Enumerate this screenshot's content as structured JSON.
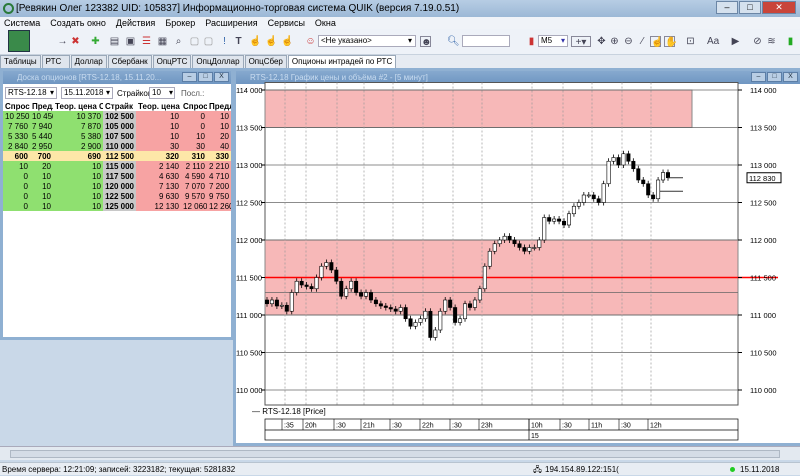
{
  "app": {
    "title": "[Ревякин Олег 123382 UID: 105837] Информационно-торговая система QUIK (версия 7.19.0.51)"
  },
  "menu": [
    "Система",
    "Создать окно",
    "Действия",
    "Брокер",
    "Расширения",
    "Сервисы",
    "Окна"
  ],
  "toolbar": {
    "account_select": "<Не указано>",
    "search_value": "",
    "interval_select": "M5"
  },
  "tabs": [
    {
      "label": "Таблицы"
    },
    {
      "label": "РТС"
    },
    {
      "label": "Доллар"
    },
    {
      "label": "Сбербанк"
    },
    {
      "label": "ОпцРТС"
    },
    {
      "label": "ОпцДоллар"
    },
    {
      "label": "ОпцСбер"
    },
    {
      "label": "Опционы интрадей по РТС",
      "active": true
    }
  ],
  "options_board": {
    "title": "Доска опционов [RTS-12.18, 15.11.20...",
    "instrument": "RTS-12.18",
    "date": "15.11.2018",
    "strikes_label": "Страйков:",
    "strikes": "10",
    "last_label": "Посл.:",
    "headers": [
      "Спрос С",
      "Предл С",
      "Теор. цена С",
      "Страйк",
      "Теор. цена P",
      "Спрос P",
      "Предл P"
    ],
    "rows": [
      [
        "10 250",
        "10 450",
        "10 370",
        "102 500",
        "10",
        "0",
        "10"
      ],
      [
        "7 760",
        "7 940",
        "7 870",
        "105 000",
        "10",
        "0",
        "10"
      ],
      [
        "5 330",
        "5 440",
        "5 380",
        "107 500",
        "10",
        "10",
        "20"
      ],
      [
        "2 840",
        "2 950",
        "2 900",
        "110 000",
        "30",
        "30",
        "40"
      ],
      [
        "600",
        "700",
        "690",
        "112 500",
        "320",
        "310",
        "330"
      ],
      [
        "10",
        "20",
        "10",
        "115 000",
        "2 140",
        "2 110",
        "2 210"
      ],
      [
        "0",
        "10",
        "10",
        "117 500",
        "4 630",
        "4 590",
        "4 710"
      ],
      [
        "0",
        "10",
        "10",
        "120 000",
        "7 130",
        "7 070",
        "7 200"
      ],
      [
        "0",
        "10",
        "10",
        "122 500",
        "9 630",
        "9 570",
        "9 750"
      ],
      [
        "0",
        "10",
        "10",
        "125 000",
        "12 130",
        "12 060",
        "12 260"
      ]
    ],
    "atm_row": 4
  },
  "chart": {
    "title": "RTS-12.18 График цены и объёма #2 - [5 минут]",
    "legend": "RTS-12.18 [Price]",
    "current_price_label": "112 830"
  },
  "chart_data": {
    "type": "candlestick",
    "series_name": "RTS-12.18 [Price]",
    "ylim": [
      109800,
      114100
    ],
    "yticks": [
      "114 000",
      "113 500",
      "113 000",
      "112 500",
      "112 000",
      "111 500",
      "111 000",
      "110 500",
      "110 000"
    ],
    "ytick_values": [
      114000,
      113500,
      113000,
      112500,
      112000,
      111500,
      111000,
      110500,
      110000
    ],
    "xticks": [
      ":35",
      "20h",
      ":30",
      "21h",
      ":30",
      "22h",
      ":30",
      "23h",
      "10h",
      ":30",
      "11h",
      ":30",
      "12h"
    ],
    "date_label": "15",
    "closes": [
      111150,
      111200,
      111120,
      111130,
      111050,
      111300,
      111450,
      111400,
      111380,
      111350,
      111500,
      111650,
      111700,
      111600,
      111450,
      111250,
      111350,
      111450,
      111300,
      111250,
      111300,
      111200,
      111150,
      111120,
      111100,
      111080,
      111050,
      111100,
      110950,
      110850,
      110900,
      110950,
      111050,
      110700,
      110800,
      111050,
      111200,
      111100,
      110900,
      110950,
      111150,
      111100,
      111200,
      111350,
      111650,
      111850,
      111950,
      112000,
      112050,
      112000,
      111950,
      111900,
      111850,
      111900,
      111900,
      112000,
      112300,
      112250,
      112280,
      112250,
      112200,
      112350,
      112450,
      112500,
      112600,
      112600,
      112550,
      112500,
      112750,
      113050,
      113100,
      113000,
      113150,
      113050,
      112950,
      112800,
      112750,
      112600,
      112550,
      112800,
      112900,
      112830
    ],
    "zones": [
      {
        "from": 113500,
        "to": 114000,
        "color": "#f7b8b8"
      },
      {
        "from": 111000,
        "to": 112000,
        "color": "#f7b8b8"
      }
    ],
    "level_line": {
      "value": 111500,
      "color": "#ff0000"
    },
    "grid_lines": [
      114000,
      113500,
      113000,
      112500,
      112000,
      111300,
      111000,
      110500,
      110000
    ],
    "grid": true
  },
  "status": {
    "text": "Время сервера: 12:21:09; записей: 3223182; текущая: 5281832",
    "server": "194.154.89.122:151(",
    "date": "15.11.2018"
  }
}
